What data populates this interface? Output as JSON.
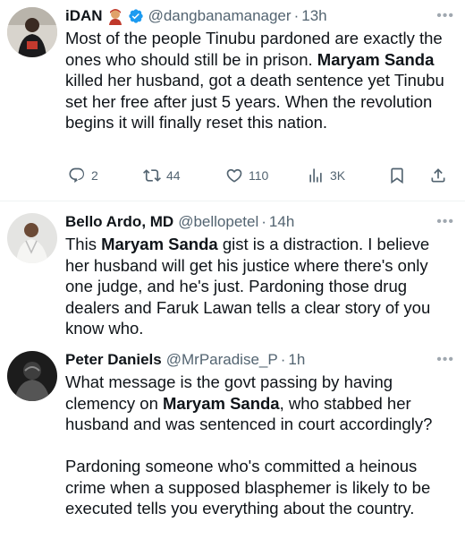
{
  "tweets": [
    {
      "name": "iDAN",
      "handle": "@dangbanamanager",
      "time": "13h",
      "more": "•••",
      "body": [
        [
          {
            "t": "Most of the people Tinubu pardoned are exactly the ones who should still be in prison. ",
            "b": false
          },
          {
            "t": "Maryam Sanda",
            "b": true
          },
          {
            "t": " killed her husband, got a death sentence yet Tinubu set her free after just 5 years. When the revolution begins it will finally reset this nation.",
            "b": false
          }
        ]
      ],
      "actions": {
        "replies": "2",
        "reposts": "44",
        "likes": "110",
        "views": "3K"
      }
    },
    {
      "name": "Bello Ardo, MD",
      "handle": "@bellopetel",
      "time": "14h",
      "more": "•••",
      "body": [
        [
          {
            "t": "This ",
            "b": false
          },
          {
            "t": "Maryam Sanda",
            "b": true
          },
          {
            "t": " gist is a distraction. I believe her husband will get his justice where there's only one judge, and he's just. Pardoning those drug dealers and Faruk Lawan tells a clear story of you know who.",
            "b": false
          }
        ]
      ]
    },
    {
      "name": "Peter Daniels",
      "handle": "@MrParadise_P",
      "time": "1h",
      "more": "•••",
      "body": [
        [
          {
            "t": "What message is the govt passing by having clemency on ",
            "b": false
          },
          {
            "t": "Maryam Sanda",
            "b": true
          },
          {
            "t": ", who stabbed her husband and was sentenced in court accordingly?",
            "b": false
          }
        ],
        [
          {
            "t": "Pardoning someone who's committed a heinous crime when a supposed blasphemer is likely to be executed tells you everything about the country.",
            "b": false
          }
        ]
      ]
    }
  ],
  "colors": {
    "text": "#0f1419",
    "secondary": "#536471",
    "verified": "#1d9bf0",
    "divider": "#eff3f4"
  },
  "icons": {
    "verified": "verified-badge-icon",
    "emoji": "person-emoji-icon",
    "reply": "reply-icon",
    "repost": "repost-icon",
    "like": "like-icon",
    "views": "views-icon",
    "bookmark": "bookmark-icon",
    "share": "share-icon"
  }
}
